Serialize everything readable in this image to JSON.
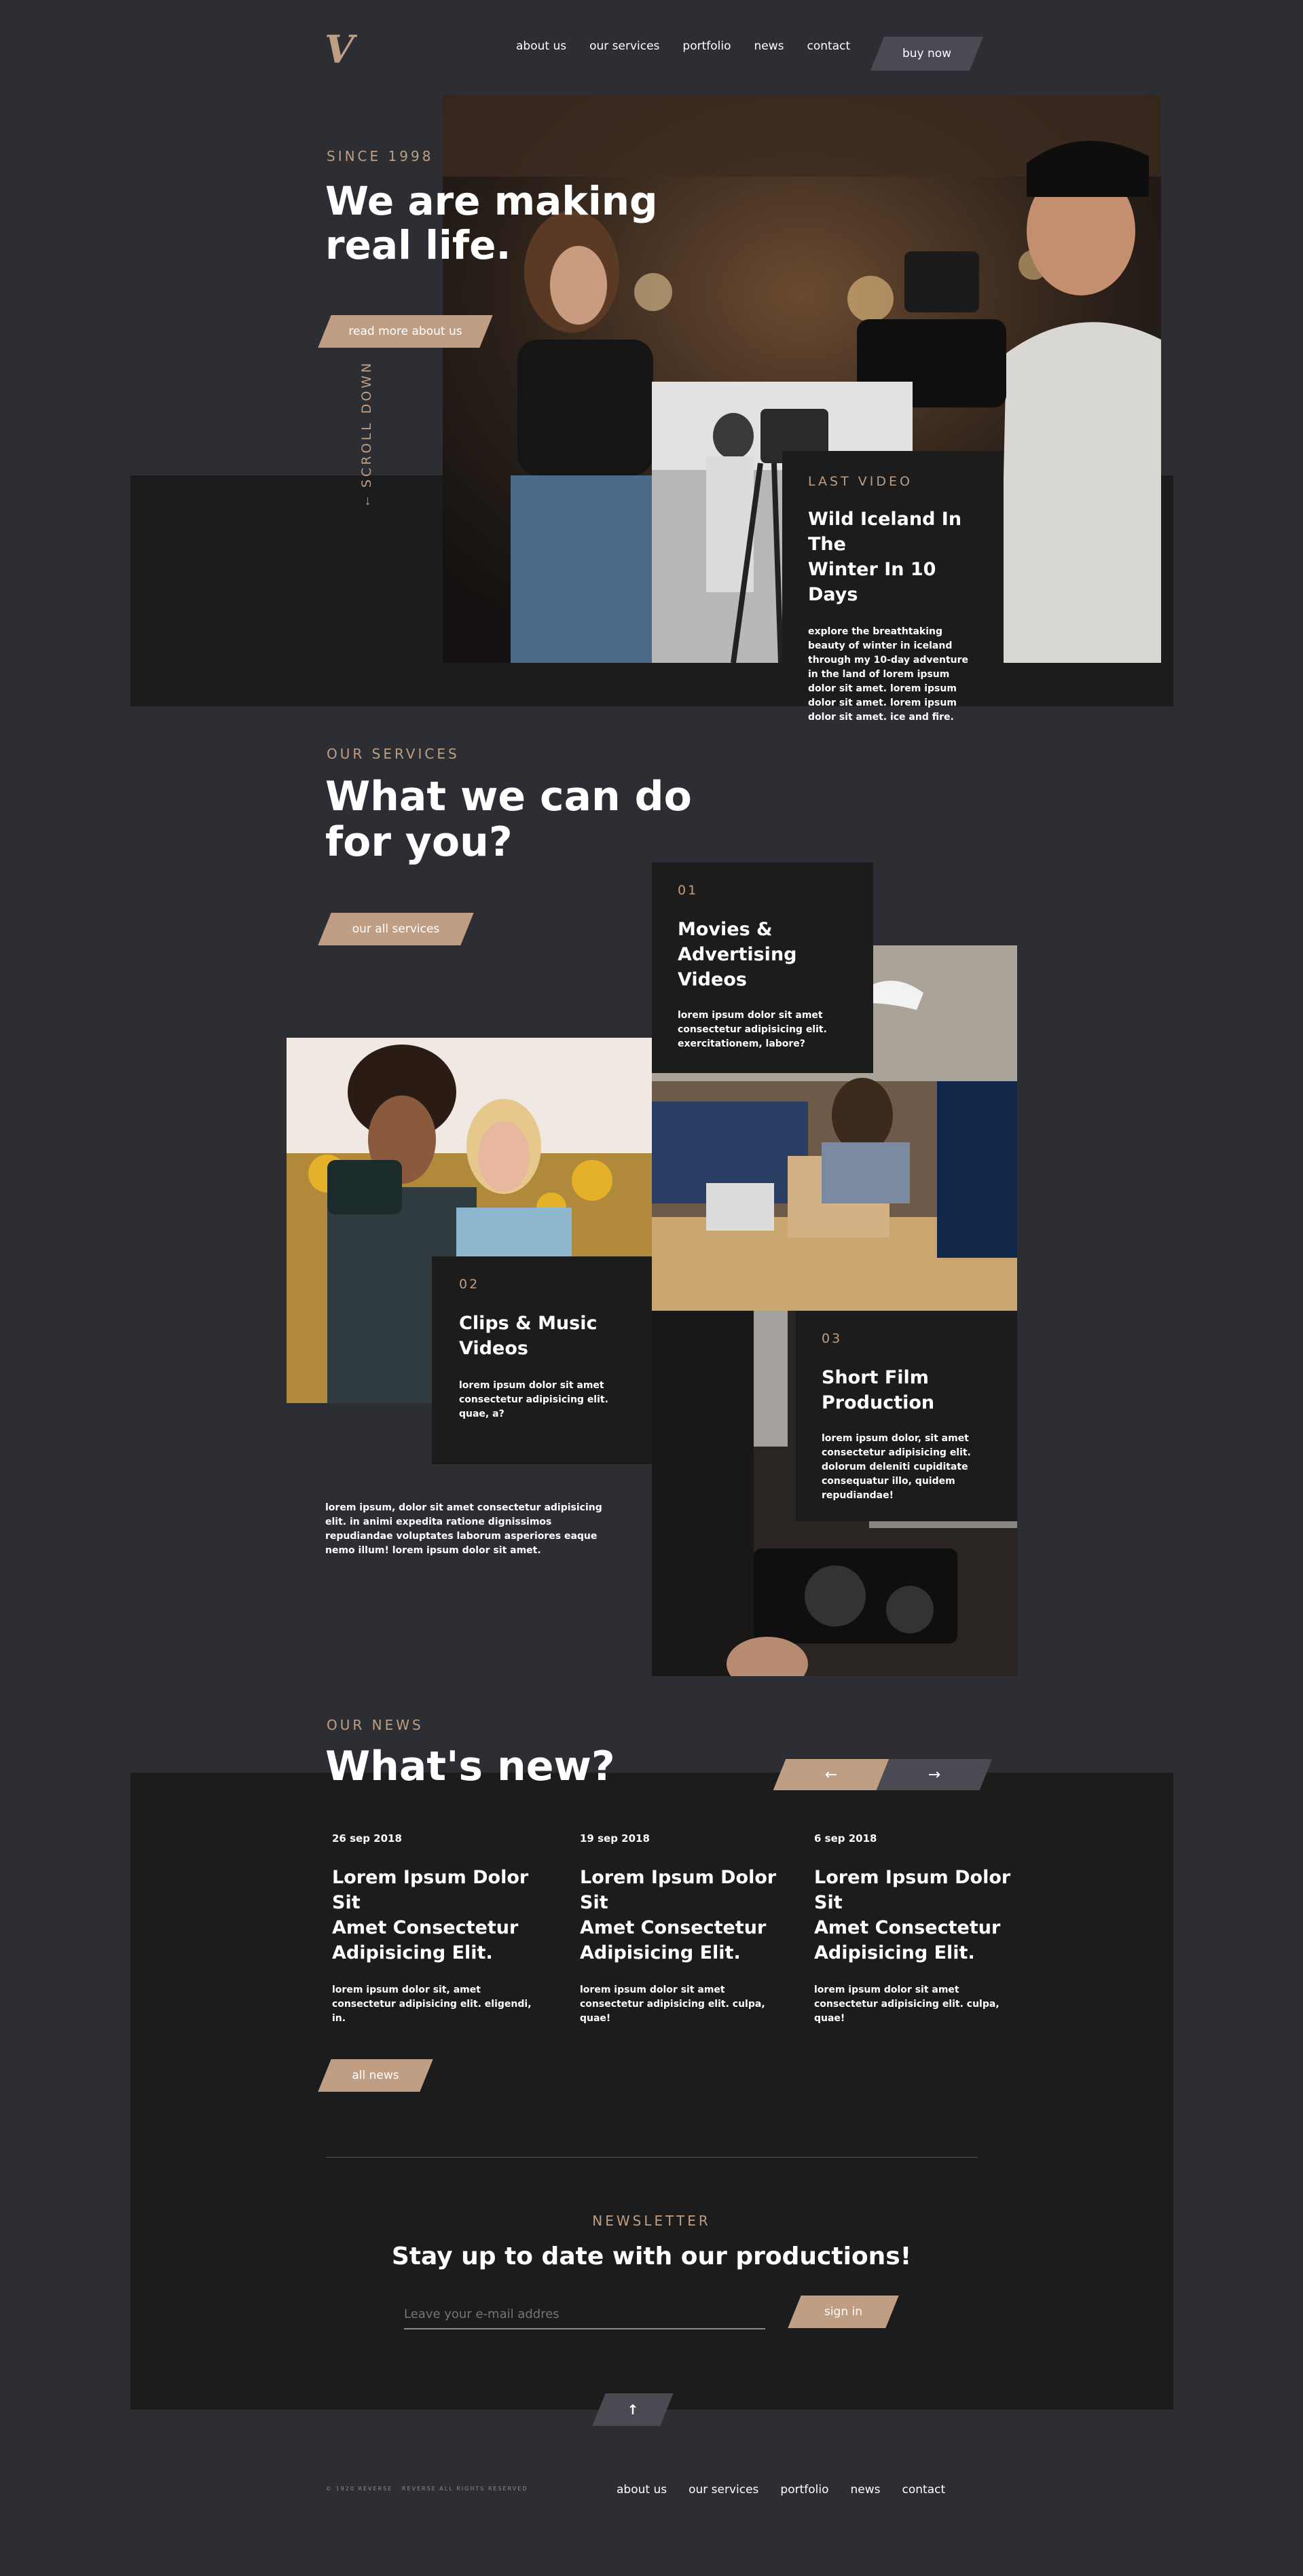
{
  "header": {
    "logo": "V",
    "nav": [
      "about us",
      "our services",
      "portfolio",
      "news",
      "contact"
    ],
    "buy_now": "buy now"
  },
  "hero": {
    "eyebrow": "SINCE 1998",
    "title_line1": "We are making",
    "title_line2": "real life.",
    "read_more": "read more about us",
    "scroll_down": "SCROLL DOWN",
    "last_video": {
      "eyebrow": "LAST VIDEO",
      "title_line1": "Wild Iceland In The",
      "title_line2": "Winter In 10 Days",
      "text": "explore the breathtaking beauty of winter in iceland through my 10-day adventure in the land of lorem ipsum dolor sit amet. lorem ipsum dolor sit amet. lorem ipsum dolor sit amet. ice and fire."
    }
  },
  "services": {
    "eyebrow": "OUR SERVICES",
    "title_line1": "What we can do",
    "title_line2": "for you?",
    "all_services": "our all services",
    "intro": "lorem ipsum, dolor sit amet consectetur adipisicing elit. in animi expedita ratione dignissimos repudiandae voluptates laborum asperiores eaque nemo illum! lorem ipsum dolor sit amet.",
    "items": [
      {
        "num": "01",
        "title_line1": "Movies &",
        "title_line2": "Advertising Videos",
        "text": "lorem ipsum dolor sit amet consectetur adipisicing elit. exercitationem, labore?"
      },
      {
        "num": "02",
        "title_line1": "Clips & Music",
        "title_line2": "Videos",
        "text": "lorem ipsum dolor sit amet consectetur adipisicing elit. quae, a?"
      },
      {
        "num": "03",
        "title_line1": "Short Film",
        "title_line2": "Production",
        "text": "lorem ipsum dolor, sit amet consectetur adipisicing elit. dolorum deleniti cupiditate consequatur illo, quidem repudiandae!"
      }
    ]
  },
  "news": {
    "eyebrow": "OUR NEWS",
    "title": "What's new?",
    "prev_arrow": "←",
    "next_arrow": "→",
    "items": [
      {
        "date": "26 sep 2018",
        "title_line1": "Lorem Ipsum Dolor Sit",
        "title_line2": "Amet Consectetur",
        "title_line3": "Adipisicing Elit.",
        "text": "lorem ipsum dolor sit, amet consectetur adipisicing elit. eligendi, in."
      },
      {
        "date": "19 sep 2018",
        "title_line1": "Lorem Ipsum Dolor Sit",
        "title_line2": "Amet Consectetur",
        "title_line3": "Adipisicing Elit.",
        "text": "lorem ipsum dolor sit amet consectetur adipisicing elit. culpa, quae!"
      },
      {
        "date": "6 sep 2018",
        "title_line1": "Lorem Ipsum Dolor Sit",
        "title_line2": "Amet Consectetur",
        "title_line3": "Adipisicing Elit.",
        "text": "lorem ipsum dolor sit amet consectetur adipisicing elit. culpa, quae!"
      }
    ],
    "all_news": "all news"
  },
  "newsletter": {
    "eyebrow": "NEWSLETTER",
    "title": "Stay up to date with our productions!",
    "placeholder": "Leave your e-mail addres",
    "sign_in": "sign in"
  },
  "back_to_top": "↑",
  "footer": {
    "copyright": "© 1920 REVERSE · REVERSE ALL RIGHTS RESERVED",
    "nav": [
      "about us",
      "our services",
      "portfolio",
      "news",
      "contact"
    ]
  },
  "colors": {
    "background": "#2d2e33",
    "panel": "#1c1c1d",
    "accent": "#bf9e83",
    "button_dark": "#4a4b52"
  }
}
